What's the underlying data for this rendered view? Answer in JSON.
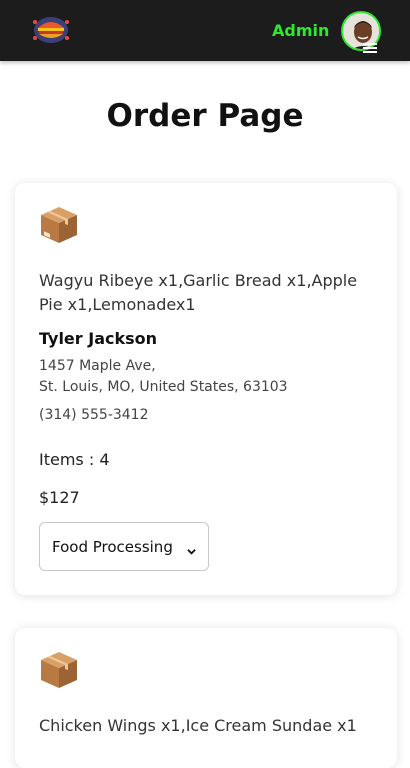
{
  "header": {
    "admin_label": "Admin",
    "logo_icon": "burger-logo-icon",
    "avatar_icon": "user-avatar",
    "menu_icon": "hamburger-menu-icon",
    "accent_color": "#2ee82e",
    "bg_color": "#1c1c1c"
  },
  "page": {
    "title": "Order Page"
  },
  "orders": [
    {
      "icon": "package-box-icon",
      "items_text": "Wagyu Ribeye x1,Garlic Bread x1,Apple Pie x1,Lemonadex1",
      "customer": "Tyler Jackson",
      "address_line1": "1457 Maple Ave,",
      "address_line2": "St. Louis, MO, United States, 63103",
      "phone": "(314) 555-3412",
      "items_count": "Items : 4",
      "price": "$127",
      "status": "Food Processing"
    },
    {
      "icon": "package-box-icon",
      "items_text": "Chicken Wings x1,Ice Cream Sundae x1"
    }
  ]
}
